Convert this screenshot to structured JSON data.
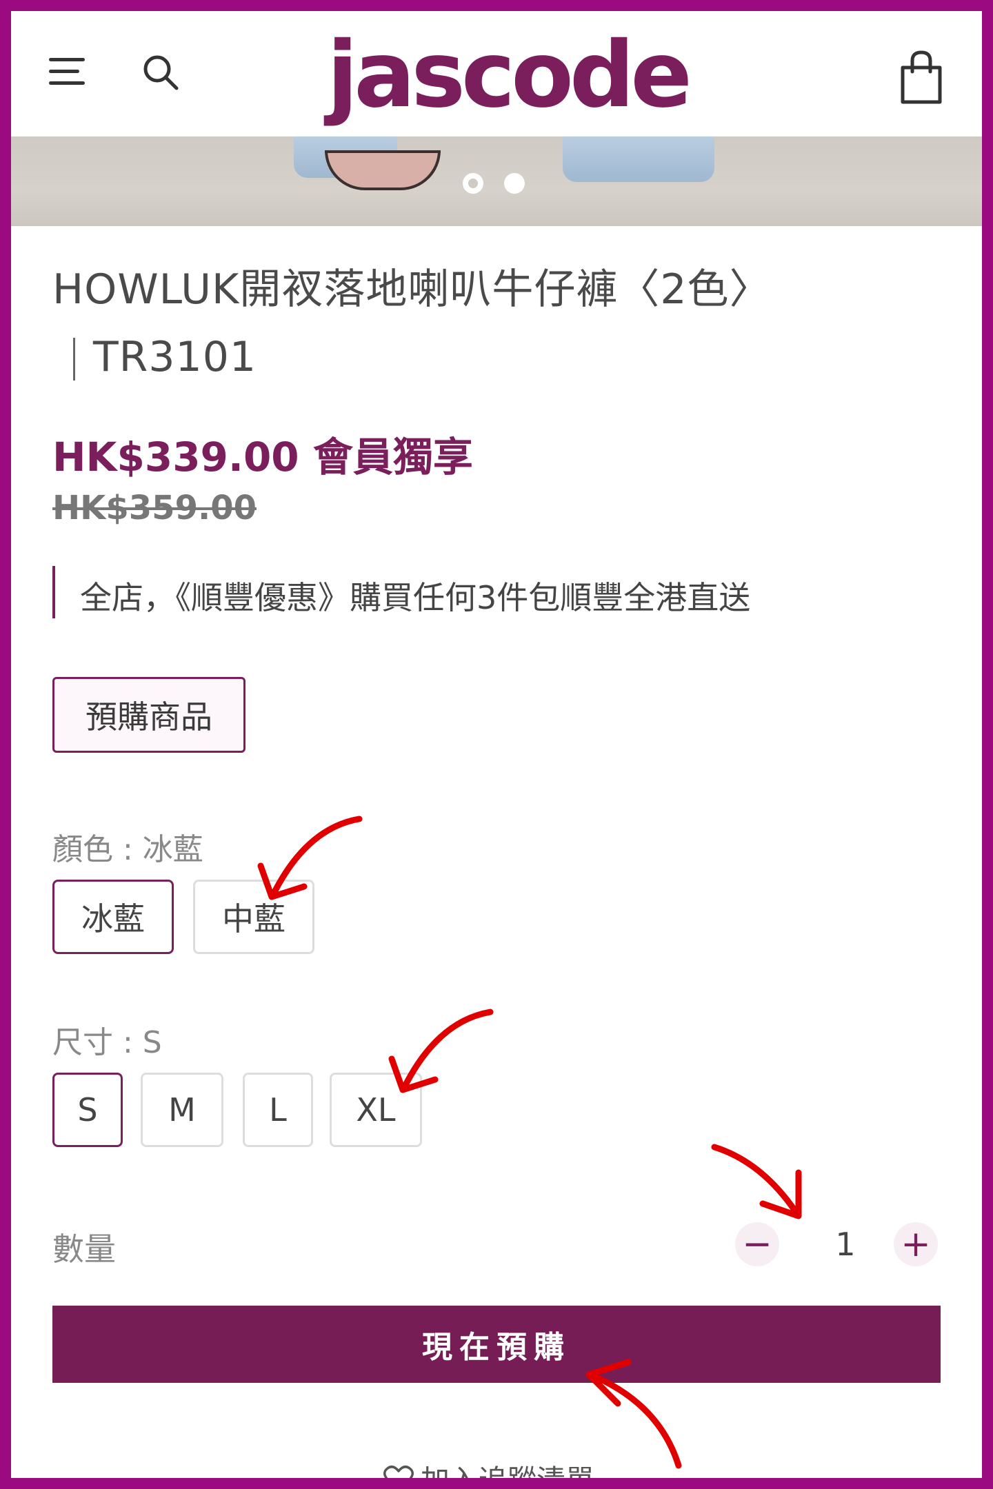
{
  "header": {
    "logo": "jascode",
    "menu_icon": "hamburger-menu-icon",
    "search_icon": "search-icon",
    "cart_icon": "shopping-bag-icon"
  },
  "gallery": {
    "slides": 2,
    "active_slide": 2
  },
  "product": {
    "title": "HOWLUK開衩落地喇叭牛仔褲〈2色〉",
    "code": "TR3101",
    "price": "HK$339.00 會員獨享",
    "original_price": "HK$359.00",
    "promo": "全店，《順豐優惠》購買任何3件包順豐全港直送",
    "badge": "預購商品"
  },
  "color": {
    "label": "顏色 : 冰藍",
    "options": [
      "冰藍",
      "中藍"
    ],
    "selected": "冰藍"
  },
  "size": {
    "label": "尺寸 : S",
    "options": [
      "S",
      "M",
      "L",
      "XL"
    ],
    "selected": "S"
  },
  "quantity": {
    "label": "數量",
    "value": "1",
    "minus": "−",
    "plus": "+"
  },
  "actions": {
    "buy_now": "現在預購",
    "wishlist": "加入追蹤清單"
  },
  "colors": {
    "brand": "#761d56",
    "frame": "#9c0a82",
    "annotation": "#e00000"
  }
}
